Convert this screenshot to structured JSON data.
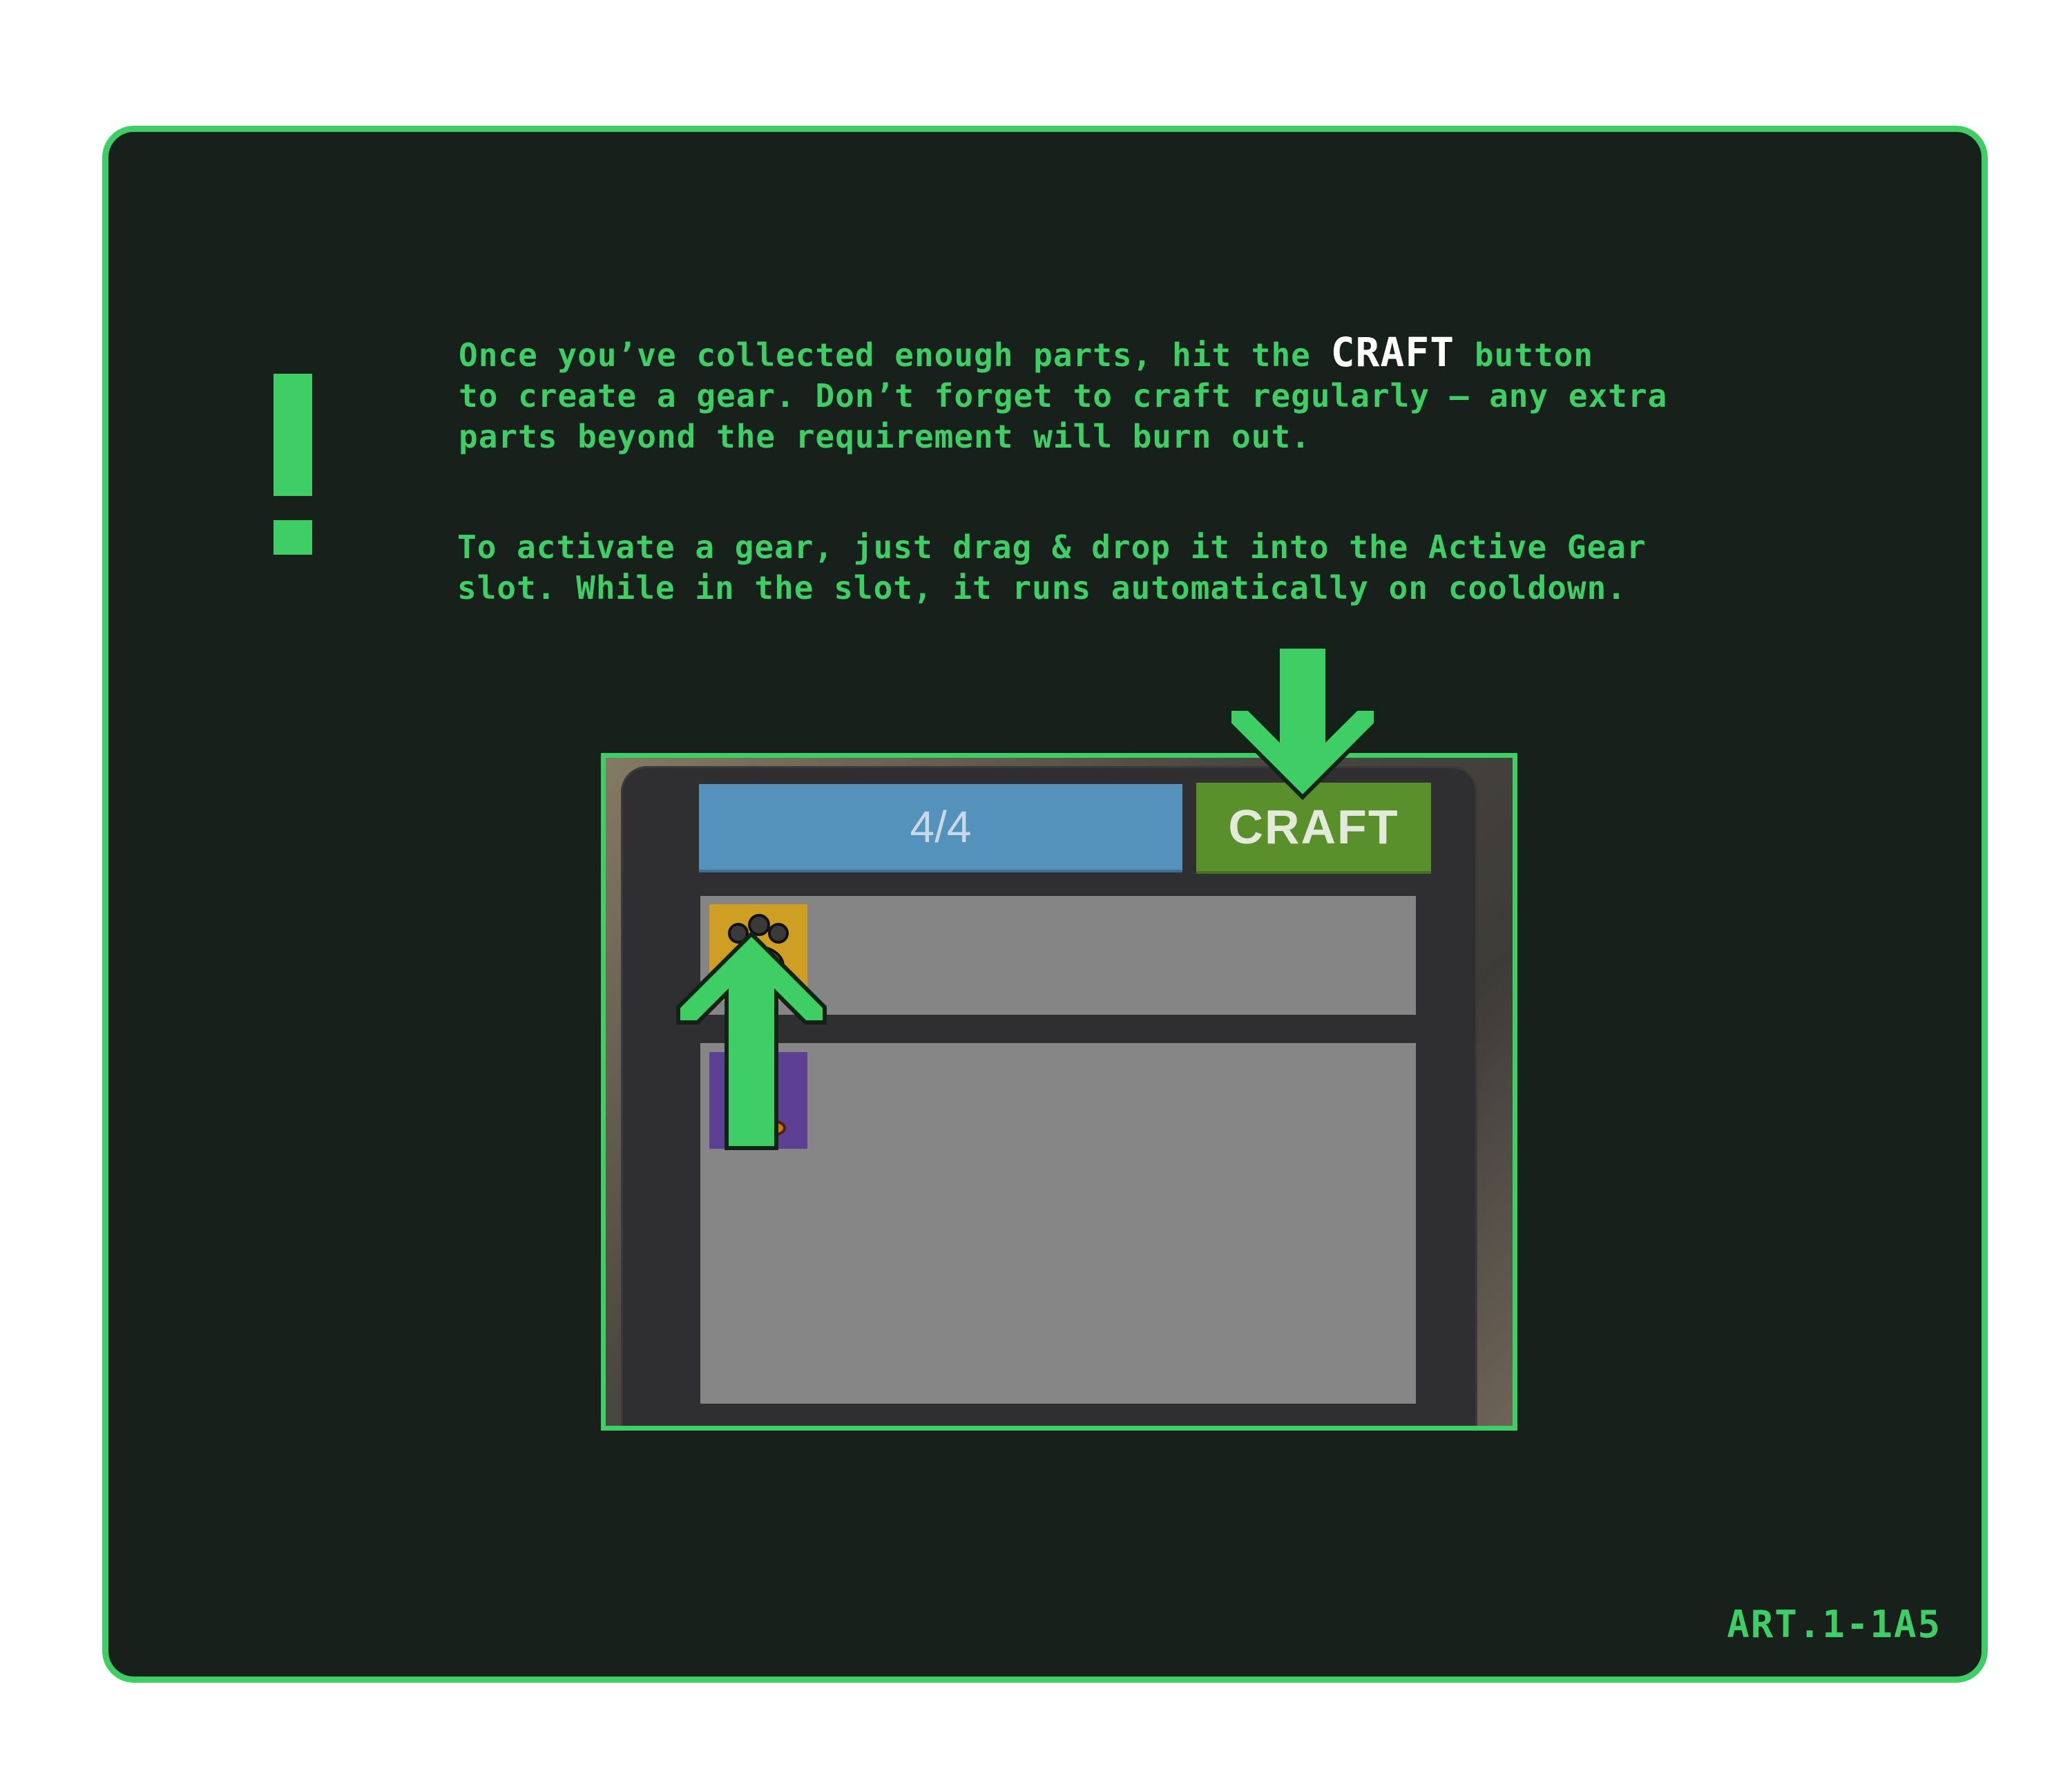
{
  "tutorial": {
    "paragraph1": {
      "line1_before": "Once you’ve collected enough parts, hit the ",
      "line1_highlight": "CRAFT",
      "line1_after": " button",
      "line2": "to create a gear. Don’t forget to craft regularly – any extra",
      "line3": "parts beyond the requirement will burn out."
    },
    "paragraph2": {
      "line1": "To activate a gear, just drag & drop it into the Active Gear",
      "line2": "slot. While in the slot, it runs automatically on cooldown."
    },
    "code": "ART.1-1A5",
    "accent_color": "#3fcd66",
    "highlight_color": "#ffffff",
    "background_color": "#18201b"
  },
  "game": {
    "progress": {
      "label": "4/4",
      "value": 1.0,
      "color": "#5592bb"
    },
    "craft_button": {
      "label": "CRAFT",
      "color": "#5a902c"
    },
    "items": [
      {
        "icon": "paw-gear-icon",
        "slot_color": "#cf9f24"
      },
      {
        "icon": "flame-gear-icon",
        "slot_color": "#5d3f93"
      }
    ],
    "arrows": [
      {
        "icon": "arrow-down-icon",
        "points_to": "craft-button"
      },
      {
        "icon": "arrow-up-icon",
        "points_to": "active-gear-slot"
      }
    ]
  }
}
